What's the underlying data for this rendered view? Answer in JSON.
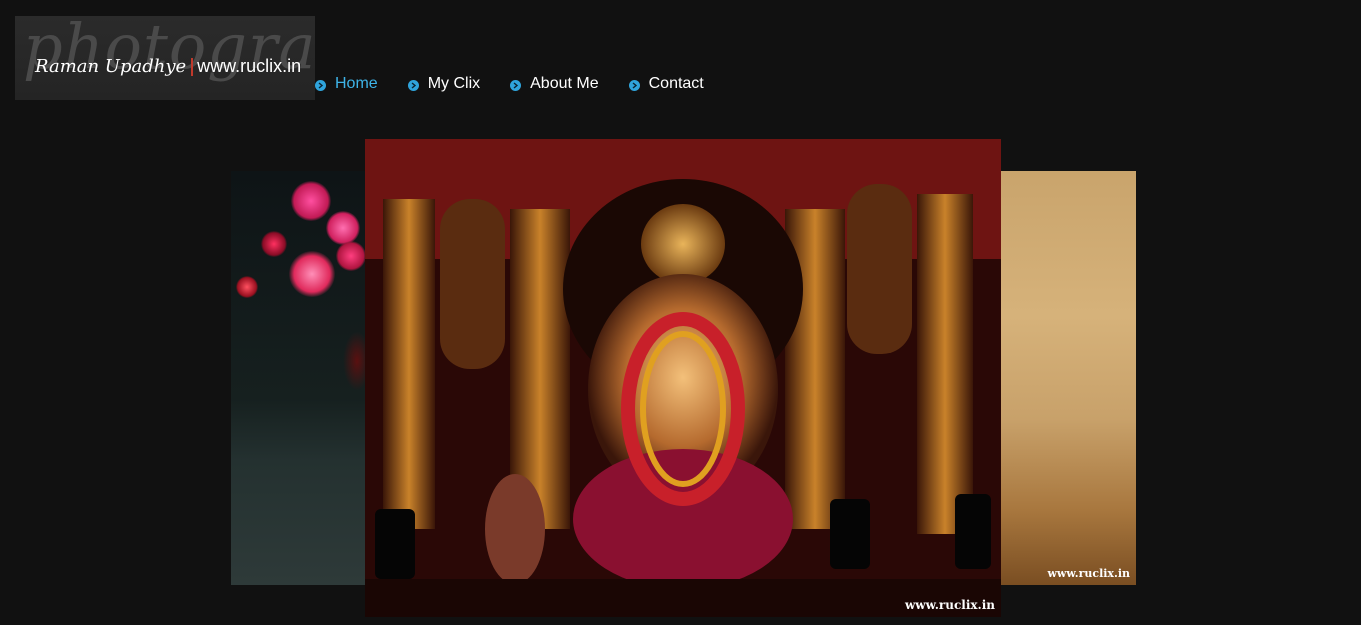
{
  "logo": {
    "watermark": "photography",
    "name": "Raman Upadhye",
    "url": "www.ruclix.in"
  },
  "nav": {
    "items": [
      {
        "label": "Home",
        "active": true
      },
      {
        "label": "My Clix",
        "active": false
      },
      {
        "label": "About Me",
        "active": false
      },
      {
        "label": "Contact",
        "active": false
      }
    ]
  },
  "slider": {
    "center_watermark": "www.ruclix.in",
    "right_watermark": "www.ruclix.in"
  },
  "colors": {
    "background": "#111111",
    "accent": "#3eb4e8",
    "nav_bullet": "#2fa4dc"
  }
}
